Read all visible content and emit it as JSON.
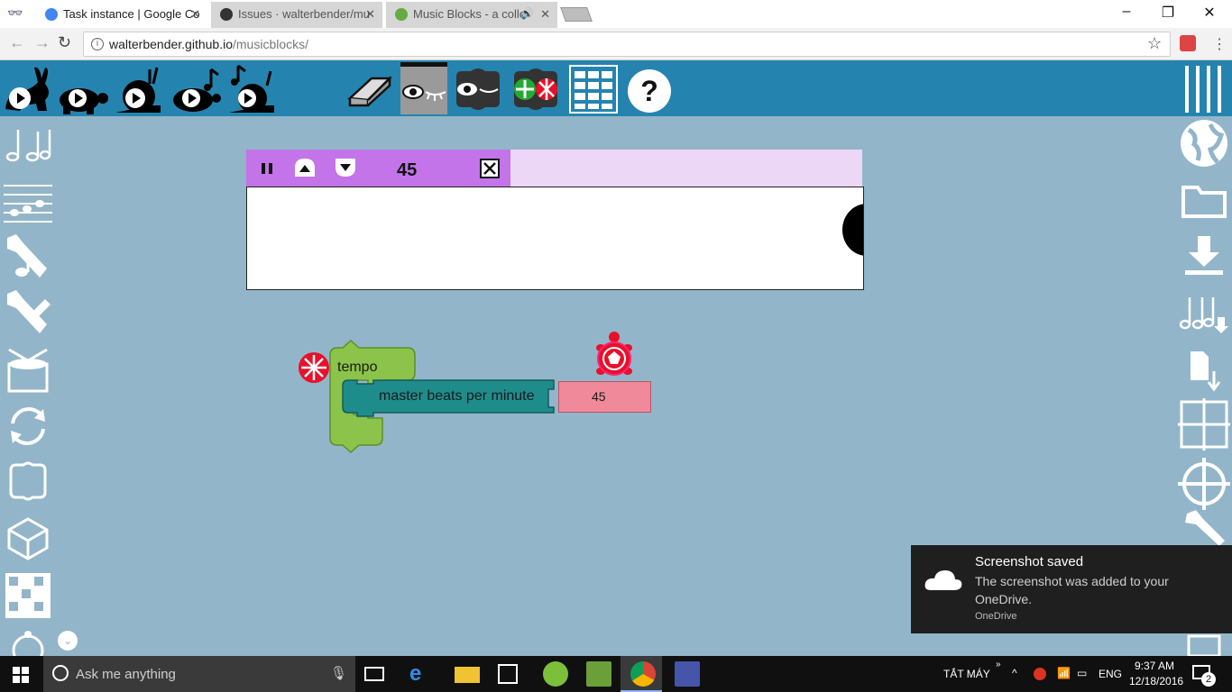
{
  "browser": {
    "tabs": [
      {
        "label": "Task instance | Google Co",
        "active": false
      },
      {
        "label": "Issues · walterbender/mu",
        "active": false
      },
      {
        "label": "Music Blocks - a colle",
        "active": true
      }
    ],
    "url_host": "walterbender.github.io",
    "url_path": "/musicblocks/",
    "window_controls": {
      "minimize": "–",
      "maximize": "❐",
      "close": "✕"
    }
  },
  "widget": {
    "value": "45"
  },
  "blocks": {
    "tempo_label": "tempo",
    "master_label": "master beats per minute",
    "master_value": "45"
  },
  "notification": {
    "title": "Screenshot saved",
    "body": "The screenshot was added to your OneDrive.",
    "app": "OneDrive"
  },
  "taskbar": {
    "search_placeholder": "Ask me anything",
    "keyboard_label": "TẮT MÁY",
    "lang": "ENG",
    "time": "9:37 AM",
    "date": "12/18/2016",
    "notifications_count": "2"
  },
  "colors": {
    "toolbar": "#2584af",
    "canvas": "#93b5c9",
    "widget_bar": "#c374e9",
    "tempo_block": "#8cc34a",
    "master_block": "#1f8c8c",
    "number_block": "#f08a9a"
  }
}
